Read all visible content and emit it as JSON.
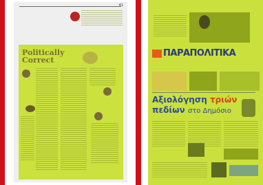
{
  "viewer": {
    "divider_color": "#d0101c",
    "highlight_color": "#c6df2a"
  },
  "left_page": {
    "page_number": "41",
    "column_title": "Politically Correct",
    "selected": true
  },
  "right_page": {
    "masthead": "ΠΑΡΑΠΟΛΙΤΙΚΑ",
    "headline_line1": "Αξιολόγηση",
    "headline_word2": "τριών",
    "headline_line2": "πεδίων",
    "headline_suffix": "στο Δημόσιο",
    "selected": true
  }
}
